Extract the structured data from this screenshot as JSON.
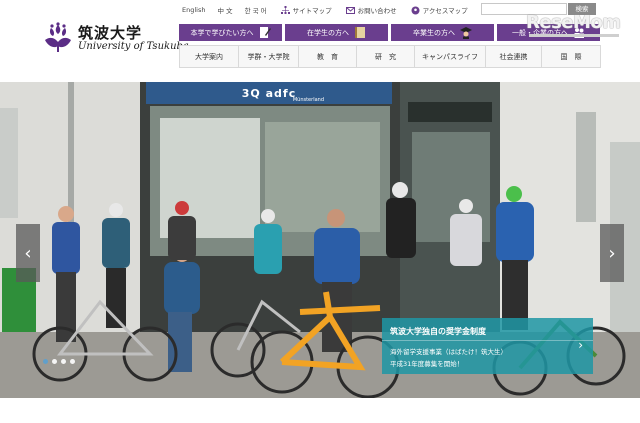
{
  "logo": {
    "name_jp": "筑波大学",
    "name_en": "University of Tsukuba",
    "icon": "paulownia-crest-icon"
  },
  "utility": {
    "languages": [
      "English",
      "中 文",
      "한 국 어"
    ],
    "links": [
      {
        "label": "サイトマップ",
        "icon": "sitemap-icon"
      },
      {
        "label": "お問い合わせ",
        "icon": "mail-icon"
      },
      {
        "label": "アクセスマップ",
        "icon": "map-pin-icon"
      }
    ],
    "search_button": "検索"
  },
  "watermark": "ReseMom",
  "audience_tabs": [
    {
      "label": "本学で学びたい方へ",
      "icon": "pen-paper-icon"
    },
    {
      "label": "在学生の方へ",
      "icon": "book-icon"
    },
    {
      "label": "卒業生の方へ",
      "icon": "graduate-icon"
    },
    {
      "label": "一般・企業の方へ",
      "icon": "people-icon"
    }
  ],
  "global_nav": [
    "大学案内",
    "学群・大学院",
    "教　育",
    "研　究",
    "キャンパスライフ",
    "社会連携",
    "国　際"
  ],
  "hero": {
    "shop_sign": "3Q adfc",
    "shop_sign_sub": "Münsterland",
    "slide_count": 4,
    "active_slide": 1,
    "caption": {
      "title": "筑波大学独自の奨学金制度",
      "line1": "海外留学支援事業（はばたけ！筑大生）",
      "line2": "平成31年度募集を開始！"
    }
  },
  "colors": {
    "accent_purple": "#6a3e8e",
    "caption_teal": "#1e96a5"
  }
}
